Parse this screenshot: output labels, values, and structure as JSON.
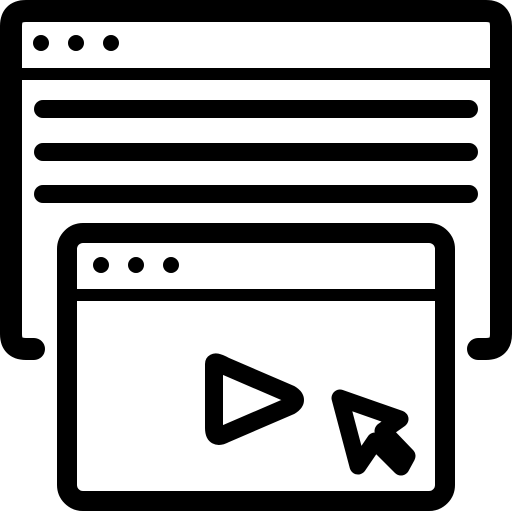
{
  "icon": {
    "name": "browser-video-icon",
    "stroke_color": "#000000",
    "background_color": "#ffffff"
  }
}
